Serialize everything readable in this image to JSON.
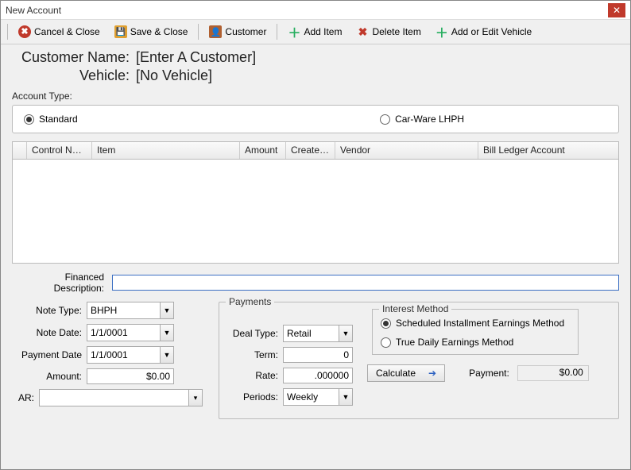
{
  "window": {
    "title": "New Account"
  },
  "toolbar": {
    "cancel": "Cancel & Close",
    "save": "Save & Close",
    "customer": "Customer",
    "add_item": "Add Item",
    "delete_item": "Delete Item",
    "add_vehicle": "Add or Edit Vehicle"
  },
  "header": {
    "customer_name_label": "Customer Name:",
    "customer_name_value": "[Enter A Customer]",
    "vehicle_label": "Vehicle:",
    "vehicle_value": "[No Vehicle]"
  },
  "account_type": {
    "label": "Account Type:",
    "standard": "Standard",
    "carware": "Car-Ware LHPH",
    "selected": "standard"
  },
  "grid": {
    "columns": [
      "Control Num…",
      "Item",
      "Amount",
      "Create Bill",
      "Vendor",
      "Bill Ledger Account"
    ],
    "rows": []
  },
  "financed_description": {
    "label": "Financed Description:",
    "value": ""
  },
  "left_form": {
    "note_type": {
      "label": "Note Type:",
      "value": "BHPH"
    },
    "note_date": {
      "label": "Note Date:",
      "value": "1/1/0001"
    },
    "payment_date": {
      "label": "Payment Date",
      "value": "1/1/0001"
    },
    "amount": {
      "label": "Amount:",
      "value": "$0.00"
    },
    "ar": {
      "label": "AR:",
      "value": ""
    }
  },
  "payments": {
    "legend": "Payments",
    "deal_type": {
      "label": "Deal Type:",
      "value": "Retail"
    },
    "term": {
      "label": "Term:",
      "value": "0"
    },
    "rate": {
      "label": "Rate:",
      "value": ".000000"
    },
    "periods": {
      "label": "Periods:",
      "value": "Weekly"
    },
    "interest": {
      "legend": "Interest Method",
      "scheduled": "Scheduled Installment Earnings Method",
      "true_daily": "True Daily Earnings Method",
      "selected": "scheduled"
    },
    "calculate": "Calculate",
    "payment_label": "Payment:",
    "payment_value": "$0.00"
  }
}
